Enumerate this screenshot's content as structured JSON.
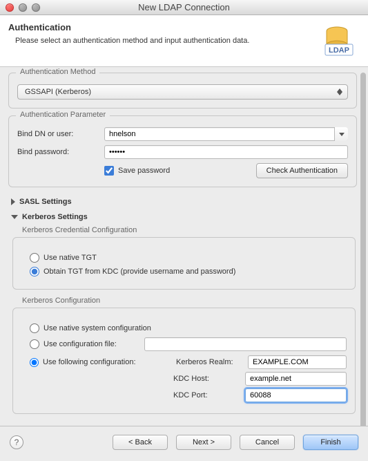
{
  "window": {
    "title": "New LDAP Connection"
  },
  "header": {
    "title": "Authentication",
    "subtitle": "Please select an authentication method and input authentication data.",
    "icon_label": "LDAP"
  },
  "auth_method": {
    "legend": "Authentication Method",
    "selected": "GSSAPI (Kerberos)"
  },
  "auth_param": {
    "legend": "Authentication Parameter",
    "bind_dn_label": "Bind DN or user:",
    "bind_dn_value": "hnelson",
    "bind_pw_label": "Bind password:",
    "bind_pw_value": "••••••",
    "save_pw_label": "Save password",
    "save_pw_checked": true,
    "check_auth_btn": "Check Authentication"
  },
  "sections": {
    "sasl_title": "SASL Settings",
    "kerb_title": "Kerberos Settings"
  },
  "kerb_cred": {
    "legend": "Kerberos Credential Configuration",
    "use_native_tgt": "Use native TGT",
    "obtain_tgt": "Obtain TGT from KDC (provide username and password)"
  },
  "kerb_conf": {
    "legend": "Kerberos Configuration",
    "use_native_sys": "Use native system configuration",
    "use_file": "Use configuration file:",
    "use_following": "Use following configuration:",
    "realm_label": "Kerberos Realm:",
    "realm_value": "EXAMPLE.COM",
    "host_label": "KDC Host:",
    "host_value": "example.net",
    "port_label": "KDC Port:",
    "port_value": "60088"
  },
  "footer": {
    "back": "< Back",
    "next": "Next >",
    "cancel": "Cancel",
    "finish": "Finish",
    "help": "?"
  }
}
